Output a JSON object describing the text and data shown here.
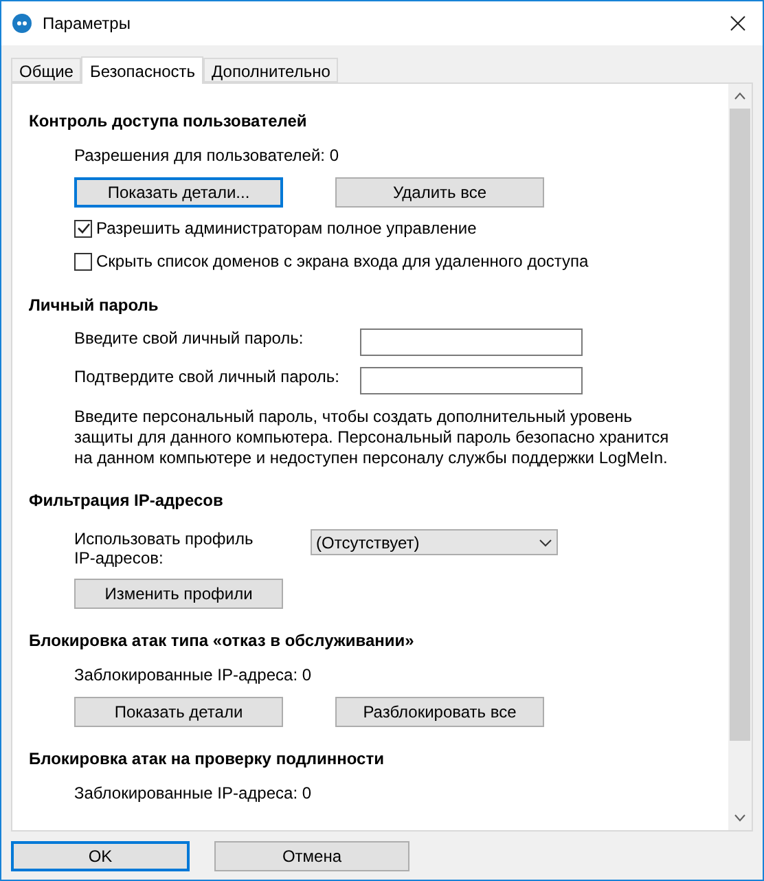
{
  "window": {
    "title": "Параметры"
  },
  "tabs": [
    {
      "label": "Общие",
      "selected": false
    },
    {
      "label": "Безопасность",
      "selected": true
    },
    {
      "label": "Дополнительно",
      "selected": false
    }
  ],
  "sections": [
    {
      "title": "Контроль доступа пользователей",
      "items": [
        {
          "kind": "text",
          "text": "Разрешения для пользователей: 0"
        },
        {
          "kind": "buttons",
          "buttons": [
            {
              "label": "Показать детали...",
              "focused": true
            },
            {
              "label": "Удалить все",
              "focused": false
            }
          ]
        },
        {
          "kind": "checkbox",
          "label": "Разрешить администраторам полное управление",
          "checked": true
        },
        {
          "kind": "checkbox",
          "label": "Скрыть список доменов с экрана входа для удаленного доступа",
          "checked": false
        }
      ]
    },
    {
      "title": "Личный пароль",
      "items": [
        {
          "kind": "field",
          "label": "Введите свой личный пароль:"
        },
        {
          "kind": "field",
          "label": "Подтвердите свой личный пароль:"
        },
        {
          "kind": "text",
          "text": "Введите персональный пароль, чтобы создать дополнительный уровень защиты для данного компьютера. Персональный пароль безопасно хранится на данном компьютере и недоступен персоналу службы поддержки LogMeIn."
        }
      ]
    },
    {
      "title": "Фильтрация IP-адресов",
      "items": [
        {
          "kind": "select",
          "label": "Использовать профиль IP-адресов:",
          "value": "(Отсутствует)"
        },
        {
          "kind": "buttons",
          "buttons": [
            {
              "label": "Изменить профили",
              "focused": false
            }
          ]
        }
      ]
    },
    {
      "title": "Блокировка атак типа «отказ в обслуживании»",
      "items": [
        {
          "kind": "text",
          "text": "Заблокированные IP-адреса: 0"
        },
        {
          "kind": "buttons",
          "buttons": [
            {
              "label": "Показать детали",
              "focused": false
            },
            {
              "label": "Разблокировать все",
              "focused": false
            }
          ]
        }
      ]
    },
    {
      "title": "Блокировка атак на проверку подлинности",
      "items": [
        {
          "kind": "text",
          "text": "Заблокированные IP-адреса: 0"
        }
      ]
    }
  ],
  "footer_buttons": [
    {
      "label": "OK",
      "focused": true
    },
    {
      "label": "Отмена",
      "focused": false
    }
  ]
}
